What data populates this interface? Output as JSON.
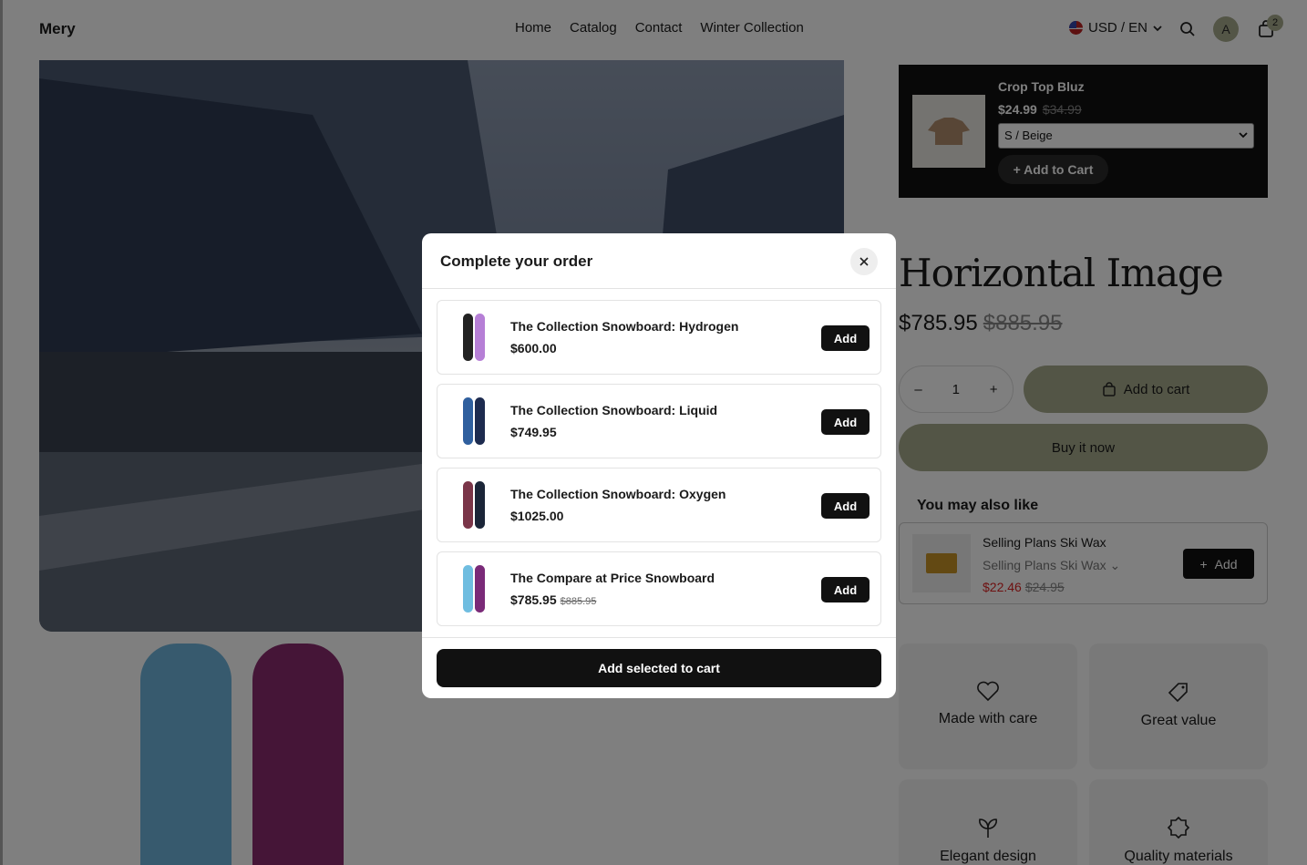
{
  "header": {
    "logo": "Mery",
    "nav": [
      "Home",
      "Catalog",
      "Contact",
      "Winter Collection"
    ],
    "locale": "USD / EN",
    "avatar_initial": "A",
    "cart_count": "2",
    "icons": [
      "search-icon",
      "cart-icon",
      "chevron-down-icon"
    ]
  },
  "upsell": {
    "title": "Crop Top Bluz",
    "price": "$24.99",
    "compare_price": "$34.99",
    "variant": "S / Beige",
    "button": "+ Add to Cart"
  },
  "product": {
    "title": "Horizontal Image",
    "price": "$785.95",
    "compare_price": "$885.95",
    "quantity": "1",
    "add_to_cart": "Add to cart",
    "buy_now": "Buy it now"
  },
  "recommendations": {
    "heading": "You may also like",
    "item": {
      "title": "Selling Plans Ski Wax",
      "variant": "Selling Plans Ski Wax",
      "price": "$22.46",
      "compare_price": "$24.95",
      "button": "Add"
    }
  },
  "features": [
    "Made with care",
    "Great value",
    "Elegant design",
    "Quality materials"
  ],
  "modal": {
    "title": "Complete your order",
    "items": [
      {
        "name": "The Collection Snowboard: Hydrogen",
        "price": "$600.00",
        "compare_price": "",
        "button": "Add"
      },
      {
        "name": "The Collection Snowboard: Liquid",
        "price": "$749.95",
        "compare_price": "",
        "button": "Add"
      },
      {
        "name": "The Collection Snowboard: Oxygen",
        "price": "$1025.00",
        "compare_price": "",
        "button": "Add"
      },
      {
        "name": "The Compare at Price Snowboard",
        "price": "$785.95",
        "compare_price": "$885.95",
        "button": "Add"
      }
    ],
    "cta": "Add selected to cart"
  },
  "colors": {
    "accent": "#a7ab8c",
    "dark": "#111111",
    "sale": "#dd2222"
  }
}
